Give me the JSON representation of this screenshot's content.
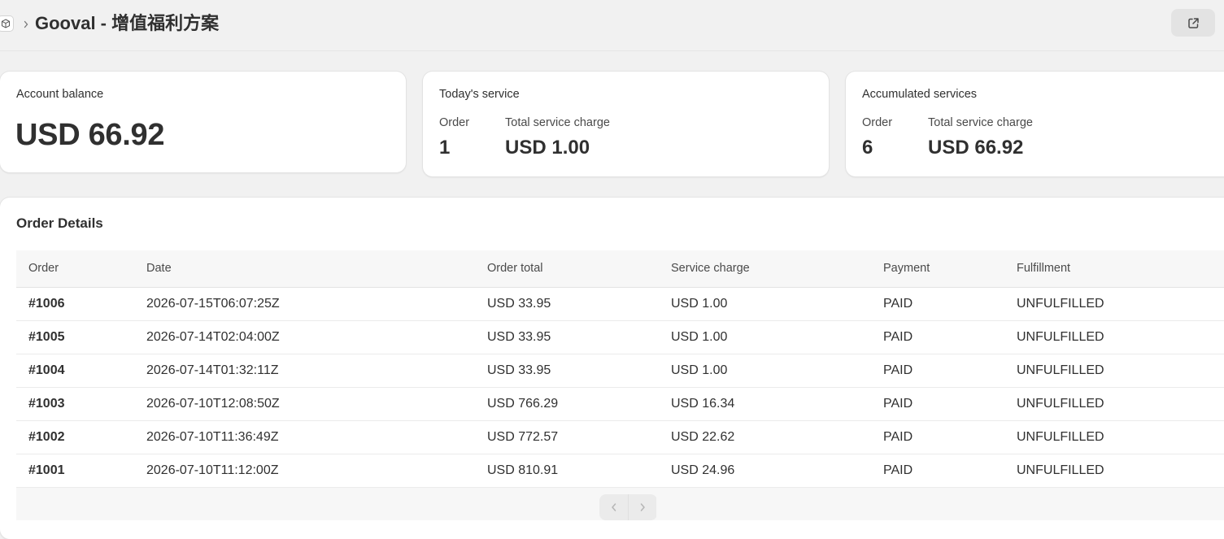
{
  "header": {
    "title": "Gooval - 增值福利方案",
    "app_icon": "app-store-icon",
    "separator_icon": "chevron-right-icon",
    "external_link_icon": "external-link-icon"
  },
  "balance_card": {
    "label": "Account balance",
    "value": "USD 66.92"
  },
  "today_card": {
    "label": "Today's service",
    "order_label": "Order",
    "order_value": "1",
    "charge_label": "Total service charge",
    "charge_value": "USD 1.00"
  },
  "accum_card": {
    "label": "Accumulated services",
    "order_label": "Order",
    "order_value": "6",
    "charge_label": "Total service charge",
    "charge_value": "USD 66.92"
  },
  "orders": {
    "title": "Order Details",
    "columns": [
      "Order",
      "Date",
      "Order total",
      "Service charge",
      "Payment",
      "Fulfillment"
    ],
    "rows": [
      {
        "order": "#1006",
        "date": "2026-07-15T06:07:25Z",
        "total": "USD 33.95",
        "charge": "USD 1.00",
        "payment": "PAID",
        "fulfillment": "UNFULFILLED"
      },
      {
        "order": "#1005",
        "date": "2026-07-14T02:04:00Z",
        "total": "USD 33.95",
        "charge": "USD 1.00",
        "payment": "PAID",
        "fulfillment": "UNFULFILLED"
      },
      {
        "order": "#1004",
        "date": "2026-07-14T01:32:11Z",
        "total": "USD 33.95",
        "charge": "USD 1.00",
        "payment": "PAID",
        "fulfillment": "UNFULFILLED"
      },
      {
        "order": "#1003",
        "date": "2026-07-10T12:08:50Z",
        "total": "USD 766.29",
        "charge": "USD 16.34",
        "payment": "PAID",
        "fulfillment": "UNFULFILLED"
      },
      {
        "order": "#1002",
        "date": "2026-07-10T11:36:49Z",
        "total": "USD 772.57",
        "charge": "USD 22.62",
        "payment": "PAID",
        "fulfillment": "UNFULFILLED"
      },
      {
        "order": "#1001",
        "date": "2026-07-10T11:12:00Z",
        "total": "USD 810.91",
        "charge": "USD 24.96",
        "payment": "PAID",
        "fulfillment": "UNFULFILLED"
      }
    ],
    "pagination": {
      "prev_icon": "chevron-left-icon",
      "next_icon": "chevron-right-icon"
    }
  },
  "colors": {
    "page_background": "#f1f1f1",
    "card_background": "#ffffff",
    "text": "#303030",
    "table_header_background": "#f7f7f7"
  }
}
